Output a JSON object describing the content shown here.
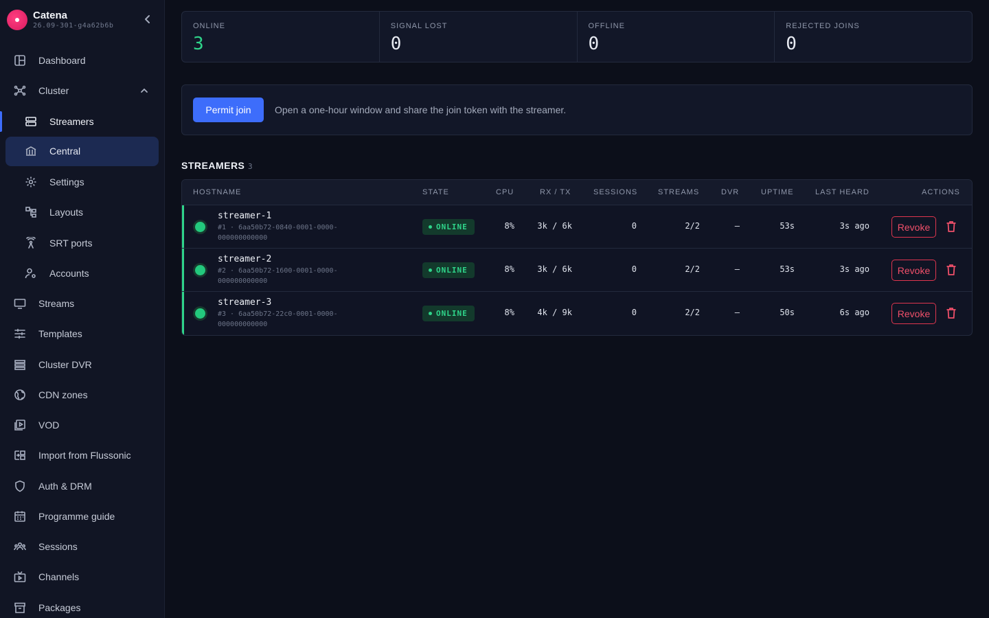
{
  "brand": {
    "name": "Catena",
    "version": "26.09-301-g4a62b6b"
  },
  "nav": {
    "dashboard": "Dashboard",
    "cluster": "Cluster",
    "streamers": "Streamers",
    "central": "Central",
    "settings": "Settings",
    "layouts": "Layouts",
    "srt_ports": "SRT ports",
    "accounts": "Accounts",
    "streams": "Streams",
    "templates": "Templates",
    "cluster_dvr": "Cluster DVR",
    "cdn_zones": "CDN zones",
    "vod": "VOD",
    "import": "Import from Flussonic",
    "auth": "Auth & DRM",
    "programme": "Programme guide",
    "sessions": "Sessions",
    "channels": "Channels",
    "packages": "Packages"
  },
  "stats": [
    {
      "label": "ONLINE",
      "value": "3"
    },
    {
      "label": "SIGNAL LOST",
      "value": "0"
    },
    {
      "label": "OFFLINE",
      "value": "0"
    },
    {
      "label": "REJECTED JOINS",
      "value": "0"
    }
  ],
  "permit": {
    "button": "Permit join",
    "text": "Open a one-hour window and share the join token with the streamer."
  },
  "streamers": {
    "title": "STREAMERS",
    "count": "3",
    "columns": {
      "hostname": "HOSTNAME",
      "state": "STATE",
      "cpu": "CPU",
      "rxtx": "RX / TX",
      "sessions": "SESSIONS",
      "streams": "STREAMS",
      "dvr": "DVR",
      "uptime": "UPTIME",
      "last_heard": "LAST HEARD",
      "actions": "ACTIONS"
    },
    "rows": [
      {
        "host": "streamer-1",
        "id1": "#1 · 6aa50b72-0840-0001-0000-",
        "id2": "000000000000",
        "state": "ONLINE",
        "cpu": "8%",
        "rxtx": "3k / 6k",
        "sessions": "0",
        "streams": "2/2",
        "dvr": "—",
        "uptime": "53s",
        "last_heard": "3s ago",
        "revoke": "Revoke"
      },
      {
        "host": "streamer-2",
        "id1": "#2 · 6aa50b72-1600-0001-0000-",
        "id2": "000000000000",
        "state": "ONLINE",
        "cpu": "8%",
        "rxtx": "3k / 6k",
        "sessions": "0",
        "streams": "2/2",
        "dvr": "—",
        "uptime": "53s",
        "last_heard": "3s ago",
        "revoke": "Revoke"
      },
      {
        "host": "streamer-3",
        "id1": "#3 · 6aa50b72-22c0-0001-0000-",
        "id2": "000000000000",
        "state": "ONLINE",
        "cpu": "8%",
        "rxtx": "4k / 9k",
        "sessions": "0",
        "streams": "2/2",
        "dvr": "—",
        "uptime": "50s",
        "last_heard": "6s ago",
        "revoke": "Revoke"
      }
    ]
  }
}
